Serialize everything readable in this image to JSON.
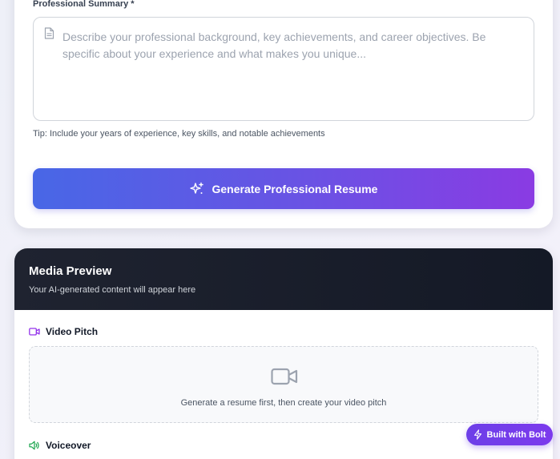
{
  "form": {
    "summary_label": "Professional Summary *",
    "summary_placeholder": "Describe your professional background, key achievements, and career objectives. Be specific about your experience and what makes you unique...",
    "tip": "Tip: Include your years of experience, key skills, and notable achievements",
    "generate_button": "Generate Professional Resume"
  },
  "media": {
    "title": "Media Preview",
    "subtitle": "Your AI-generated content will appear here",
    "video_section": "Video Pitch",
    "video_empty": "Generate a resume first, then create your video pitch",
    "voice_section": "Voiceover"
  },
  "badge": {
    "label": "Built with Bolt"
  },
  "colors": {
    "gradient_start": "#4867e6",
    "gradient_end": "#8a3be3",
    "header_dark": "#1a1f2c",
    "video_icon": "#9333ea",
    "voice_icon": "#16a34a",
    "badge": "#7c3aed"
  },
  "icons": {
    "summary_field": "document-icon",
    "generate": "sparkles-icon",
    "video": "video-camera-icon",
    "voice": "speaker-icon",
    "badge": "lightning-bolt-icon"
  }
}
